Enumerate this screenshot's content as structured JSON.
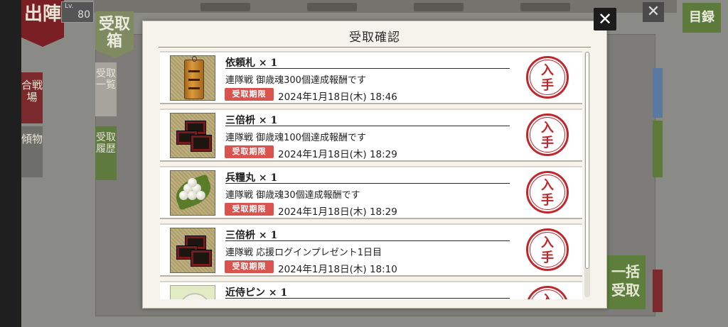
{
  "background": {
    "sortie_tab": "出陣",
    "level_label": "Lv.",
    "level_value": "80",
    "receive_box_tab": "受取箱",
    "side_menu": [
      "合戦場",
      "傾物"
    ],
    "sub_tabs": [
      "受取一覧",
      "受取履歴"
    ],
    "list_button": "目録",
    "bulk_button": "一括受取"
  },
  "modal": {
    "title": "受取確認",
    "close_icon": "close-icon",
    "items": [
      {
        "icon": "request-tag-icon",
        "name": "依頼札 × 1",
        "description": "連隊戦 御歳魂300個達成報酬です",
        "limit_label": "受取期限",
        "deadline": "2024年1月18日(木) 18:46",
        "receive_label_1": "入",
        "receive_label_2": "手"
      },
      {
        "icon": "triple-box-icon",
        "name": "三倍枡 × 1",
        "description": "連隊戦 御歳魂100個達成報酬です",
        "limit_label": "受取期限",
        "deadline": "2024年1月18日(木) 18:29",
        "receive_label_1": "入",
        "receive_label_2": "手"
      },
      {
        "icon": "rice-ball-icon",
        "name": "兵糧丸 × 1",
        "description": "連隊戦 御歳魂30個達成報酬です",
        "limit_label": "受取期限",
        "deadline": "2024年1月18日(木) 18:29",
        "receive_label_1": "入",
        "receive_label_2": "手"
      },
      {
        "icon": "triple-box-icon",
        "name": "三倍枡 × 1",
        "description": "連隊戦 応援ログインプレゼント1日目",
        "limit_label": "受取期限",
        "deadline": "2024年1月18日(木) 18:10",
        "receive_label_1": "入",
        "receive_label_2": "手"
      },
      {
        "icon": "attendant-pin-icon",
        "name": "近侍ピン × 1",
        "description": "",
        "limit_label": "",
        "deadline": "",
        "receive_label_1": "入",
        "receive_label_2": "手"
      }
    ]
  },
  "colors": {
    "accent_red": "#c0272d",
    "badge_red": "#d9534f",
    "modal_bg": "#f5f3ec"
  }
}
